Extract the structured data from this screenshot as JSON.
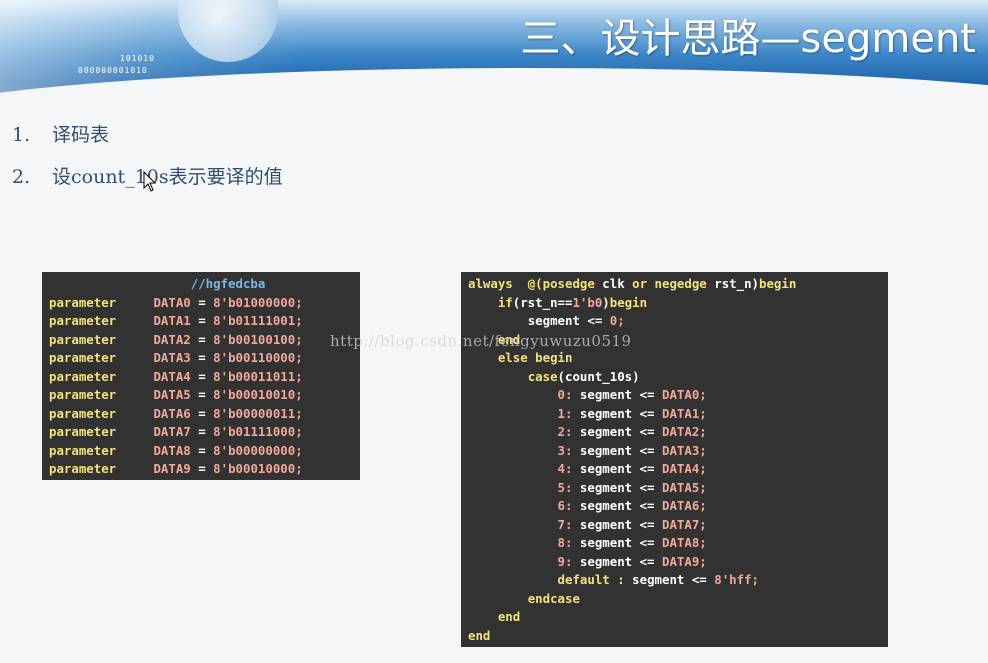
{
  "header": {
    "title": "三、设计思路—segment",
    "binary_line1": "101010",
    "binary_line2": "000000001010"
  },
  "list": [
    {
      "num": "1.",
      "text": "译码表"
    },
    {
      "num": "2.",
      "text": "设count_10s表示要译的值"
    }
  ],
  "params_code": {
    "comment": "//hgfedcba",
    "rows": [
      {
        "keyword": "parameter",
        "name": "DATA0",
        "value": "8'b01000000;"
      },
      {
        "keyword": "parameter",
        "name": "DATA1",
        "value": "8'b01111001;"
      },
      {
        "keyword": "parameter",
        "name": "DATA2",
        "value": "8'b00100100;"
      },
      {
        "keyword": "parameter",
        "name": "DATA3",
        "value": "8'b00110000;"
      },
      {
        "keyword": "parameter",
        "name": "DATA4",
        "value": "8'b00011011;"
      },
      {
        "keyword": "parameter",
        "name": "DATA5",
        "value": "8'b00010010;"
      },
      {
        "keyword": "parameter",
        "name": "DATA6",
        "value": "8'b00000011;"
      },
      {
        "keyword": "parameter",
        "name": "DATA7",
        "value": "8'b01111000;"
      },
      {
        "keyword": "parameter",
        "name": "DATA8",
        "value": "8'b00000000;"
      },
      {
        "keyword": "parameter",
        "name": "DATA9",
        "value": "8'b00010000;"
      }
    ]
  },
  "always_code": {
    "always": "always",
    "at_paren": "@(",
    "posedge": "posedge",
    "clk": "clk",
    "or": "or",
    "negedge": "negedge",
    "rst_n_close": "rst_n)",
    "begin": "begin",
    "if": "if",
    "if_cond_open": "(rst_n==",
    "if_cond_val": "1'b0",
    "if_cond_close": ")",
    "reset_target": "segment <=",
    "reset_value": "0;",
    "end": "end",
    "else": "else",
    "case": "case",
    "case_expr": "(count_10s)",
    "cases": [
      {
        "label": "0:",
        "target": "segment <=",
        "value": "DATA0;"
      },
      {
        "label": "1:",
        "target": "segment <=",
        "value": "DATA1;"
      },
      {
        "label": "2:",
        "target": "segment <=",
        "value": "DATA2;"
      },
      {
        "label": "3:",
        "target": "segment <=",
        "value": "DATA3;"
      },
      {
        "label": "4:",
        "target": "segment <=",
        "value": "DATA4;"
      },
      {
        "label": "5:",
        "target": "segment <=",
        "value": "DATA5;"
      },
      {
        "label": "6:",
        "target": "segment <=",
        "value": "DATA6;"
      },
      {
        "label": "7:",
        "target": "segment <=",
        "value": "DATA7;"
      },
      {
        "label": "8:",
        "target": "segment <=",
        "value": "DATA8;"
      },
      {
        "label": "9:",
        "target": "segment <=",
        "value": "DATA9;"
      }
    ],
    "default_kw": "default",
    "default_colon": ":",
    "default_target": "segment <=",
    "default_value": "8'hff;",
    "endcase": "endcase"
  },
  "watermark": "http://blog.csdn.net/fengyuwuzu0519",
  "colors": {
    "code_bg": "#323232",
    "keyword": "#f4e27a",
    "number": "#f1a999",
    "comment": "#79b6e9",
    "list_text": "#2d4f73"
  }
}
